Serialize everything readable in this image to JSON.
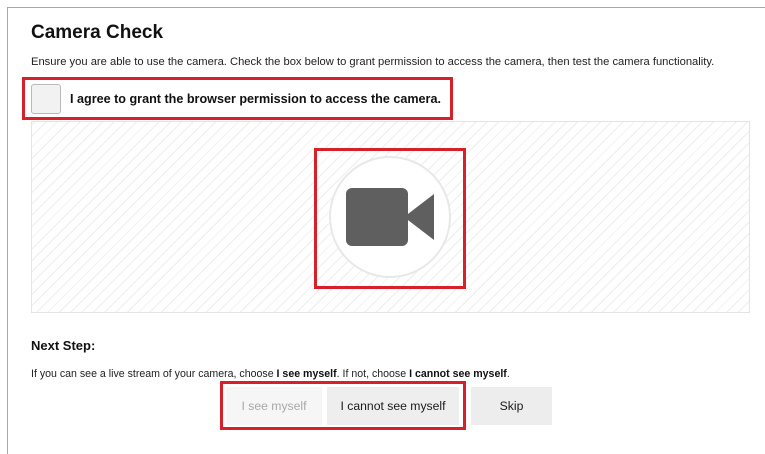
{
  "header": {
    "title": "Camera Check",
    "description": "Ensure you are able to use the camera. Check the box below to grant permission to access the camera, then test the camera functionality."
  },
  "consent": {
    "label": "I agree to grant the browser permission to access the camera.",
    "checked": false
  },
  "preview": {
    "icon": "video-camera-icon"
  },
  "next_step": {
    "title": "Next Step:",
    "instruction_parts": [
      "If you can see a live stream of your camera, choose ",
      "I see myself",
      ". If not, choose ",
      "I cannot see myself",
      "."
    ]
  },
  "buttons": {
    "see_myself": "I see myself",
    "cannot_see_myself": "I cannot see myself",
    "skip": "Skip"
  },
  "colors": {
    "highlight": "#d6202a",
    "camera_icon": "#5f5f5f"
  }
}
